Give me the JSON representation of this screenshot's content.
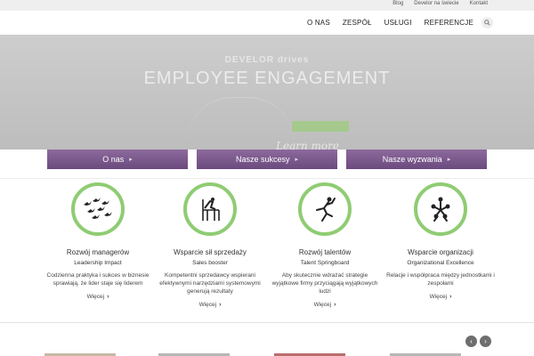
{
  "topbar": {
    "links": [
      "Blog",
      "Develor na świecie",
      "Kontakt"
    ]
  },
  "nav": {
    "items": [
      "O NAS",
      "ZESPÓŁ",
      "USŁUGI",
      "REFERENCJE"
    ]
  },
  "hero": {
    "brand": "DEVELOR drives",
    "title": "EMPLOYEE ENGAGEMENT",
    "cta": "",
    "script": "Learn more"
  },
  "tabs": [
    {
      "label": "O nas"
    },
    {
      "label": "Nasze sukcesy"
    },
    {
      "label": "Nasze wyzwania"
    }
  ],
  "cards": [
    {
      "title": "Rozwój managerów",
      "subtitle": "Leadership Impact",
      "desc": "Codzienna praktyka i sukces w biznesie sprawiają, że lider staje się liderem",
      "more": "Więcej",
      "icon": "birds-icon"
    },
    {
      "title": "Wsparcie sił sprzedaży",
      "subtitle": "Sales booster",
      "desc": "Kompetentni sprzedawcy wspierani efektywnymi narzędziami systemowymi generują rezultaty",
      "more": "Więcej",
      "icon": "chair-icon"
    },
    {
      "title": "Rozwój talentów",
      "subtitle": "Talent Springboard",
      "desc": "Aby skutecznie wdrażać strategie wyjątkowe firmy przyciągają wyjątkowych ludzi",
      "more": "Więcej",
      "icon": "jumper-icon"
    },
    {
      "title": "Wsparcie organizacji",
      "subtitle": "Organizational Excellence",
      "desc": "Relacje i współpraca między jednostkami i zespołami",
      "more": "Więcej",
      "icon": "team-icon"
    }
  ],
  "colors": {
    "accent_purple": "#7a5a8c",
    "ring_green": "#8fcc73"
  }
}
